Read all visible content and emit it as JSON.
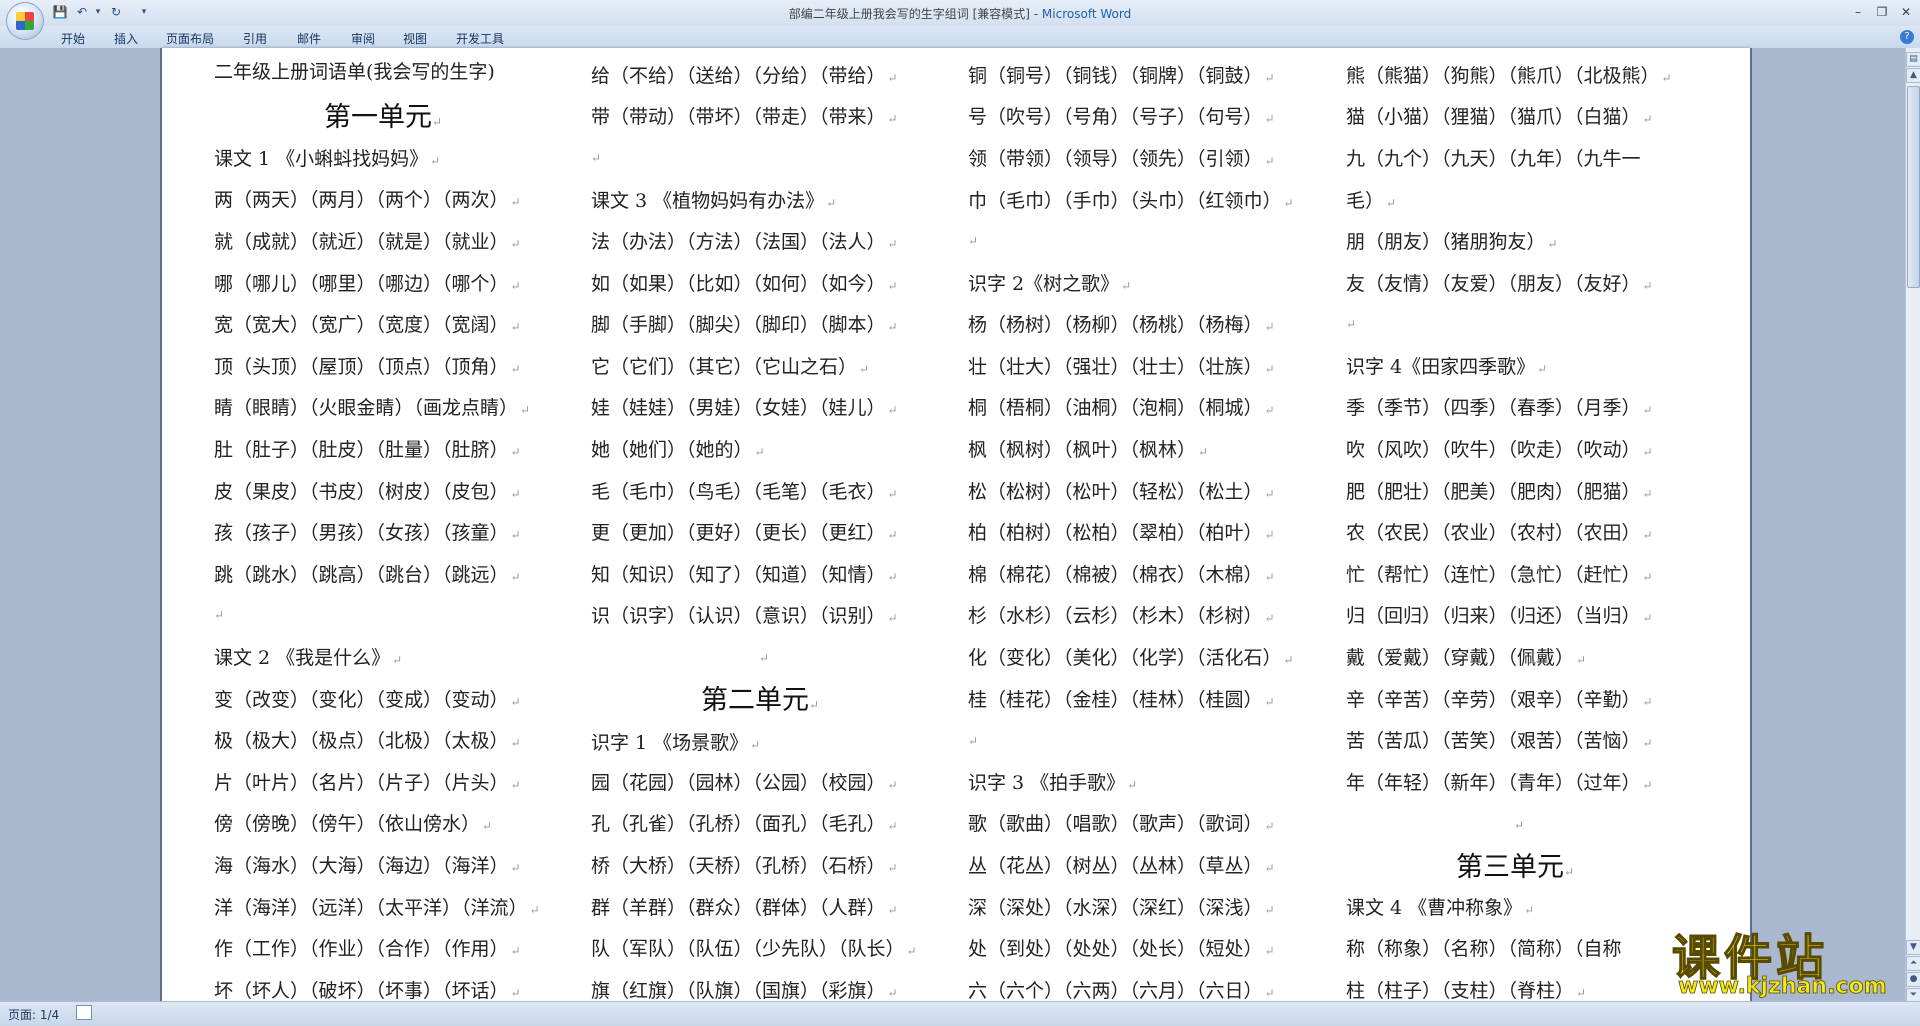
{
  "window": {
    "title": "部编二年级上册我会写的生字组词 [兼容模式] - ",
    "app_name": "Microsoft Word"
  },
  "ribbon": {
    "tabs": [
      "开始",
      "插入",
      "页面布局",
      "引用",
      "邮件",
      "审阅",
      "视图",
      "开发工具"
    ]
  },
  "status": {
    "page_count": "页面: 1/4"
  },
  "watermark": {
    "main": "课件站",
    "url": "www.kjzhan.com"
  },
  "document": {
    "col1": [
      "二年级上册词语单(我会写的生字)",
      "课文 1 《小蝌蚪找妈妈》",
      "两（两天）（两月）（两个）（两次）",
      "就（成就）（就近）（就是）（就业）",
      "哪（哪儿）（哪里）（哪边）（哪个）",
      "宽（宽大）（宽广）（宽度）（宽阔）",
      "顶（头顶）（屋顶）（顶点）（顶角）",
      "睛（眼睛）（火眼金睛）（画龙点睛）",
      "肚（肚子）（肚皮）（肚量）（肚脐）",
      "皮（果皮）（书皮）（树皮）（皮包）",
      "孩（孩子）（男孩）（女孩）（孩童）",
      "跳（跳水）（跳高）（跳台）（跳远）",
      "课文 2 《我是什么》",
      "变（改变）（变化）（变成）（变动）",
      "极（极大）（极点）（北极）（太极）",
      "片（叶片）（名片）（片子）（片头）",
      "傍（傍晚）（傍午）（依山傍水）",
      "海（海水）（大海）（海边）（海洋）",
      "洋（海洋）（远洋）（太平洋）（洋流）",
      "作（工作）（作业）（合作）（作用）",
      "坏（坏人）（破坏）（坏事）（坏话）"
    ],
    "col2": [
      "给（不给）（送给）（分给）（带给）",
      "带（带动）（带坏）（带走）（带来）",
      "课文 3 《植物妈妈有办法》",
      "法（办法）（方法）（法国）（法人）",
      "如（如果）（比如）（如何）（如今）",
      "脚（手脚）（脚尖）（脚印）（脚本）",
      "它（它们）（其它）（它山之石）",
      "娃（娃娃）（男娃）（女娃）（娃儿）",
      "她（她们）（她的）",
      "毛（毛巾）（鸟毛）（毛笔）（毛衣）",
      "更（更加）（更好）（更长）（更红）",
      "知（知识）（知了）（知道）（知情）",
      "识（识字）（认识）（意识）（识别）",
      "第二单元",
      "识字 1 《场景歌》",
      "园（花园）（园林）（公园）（校园）",
      "孔（孔雀）（孔桥）（面孔）（毛孔）",
      "桥（大桥）（天桥）（孔桥）（石桥）",
      "群（羊群）（群众）（群体）（人群）",
      "队（军队）（队伍）（少先队）（队长）",
      "旗（红旗）（队旗）（国旗）（彩旗）"
    ],
    "col3": [
      "铜（铜号）（铜钱）（铜牌）（铜鼓）",
      "号（吹号）（号角）（号子）（句号）",
      "领（带领）（领导）（领先）（引领）",
      "巾（毛巾）（手巾）（头巾）（红领巾）",
      "识字 2《树之歌》",
      "杨（杨树）（杨柳）（杨桃）（杨梅）",
      "壮（壮大）（强壮）（壮士）（壮族）",
      "桐（梧桐）（油桐）（泡桐）（桐城）",
      "枫（枫树）（枫叶）（枫林）",
      "松（松树）（松叶）（轻松）（松土）",
      "柏（柏树）（松柏）（翠柏）（柏叶）",
      "棉（棉花）（棉被）（棉衣）（木棉）",
      "杉（水杉）（云杉）（杉木）（杉树）",
      "化（变化）（美化）（化学）（活化石）",
      "桂（桂花）（金桂）（桂林）（桂圆）",
      "识字 3 《拍手歌》",
      "歌（歌曲）（唱歌）（歌声）（歌词）",
      "丛（花丛）（树丛）（丛林）（草丛）",
      "深（深处）（水深）（深红）（深浅）",
      "处（到处）（处处）（处长）（短处）",
      "六（六个）（六两）（六月）（六日）"
    ],
    "col4": [
      "熊（熊猫）（狗熊）（熊爪）（北极熊）",
      "猫（小猫）（狸猫）（猫爪）（白猫）",
      "九（九个）（九天）（九年）（九牛一",
      "毛）",
      "朋（朋友）（猪朋狗友）",
      "友（友情）（友爱）（朋友）（友好）",
      "识字 4《田家四季歌》",
      "季（季节）（四季）（春季）（月季）",
      "吹（风吹）（吹牛）（吹走）（吹动）",
      "肥（肥壮）（肥美）（肥肉）（肥猫）",
      "农（农民）（农业）（农村）（农田）",
      "忙（帮忙）（连忙）（急忙）（赶忙）",
      "归（回归）（归来）（归还）（当归）",
      "戴（爱戴）（穿戴）（佩戴）",
      "辛（辛苦）（辛劳）（艰辛）（辛勤）",
      "苦（苦瓜）（苦笑）（艰苦）（苦恼）",
      "年（年轻）（新年）（青年）（过年）",
      "第三单元",
      "课文 4 《曹冲称象》",
      "称（称象）（名称）（简称）（自称",
      "柱（柱子）（支柱）（脊柱）"
    ],
    "unit1": "第一单元"
  }
}
